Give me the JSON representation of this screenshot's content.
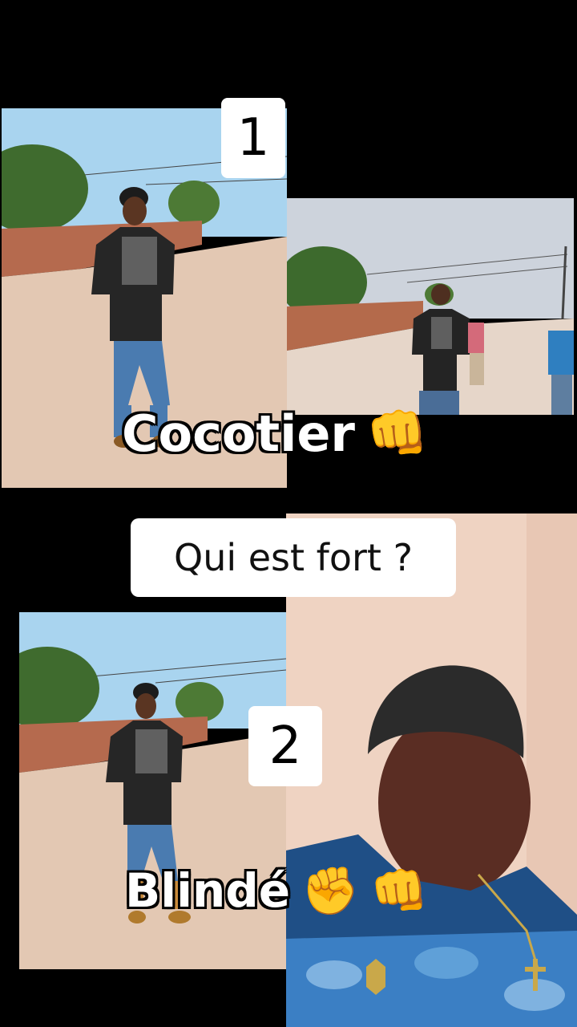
{
  "badges": {
    "first": "1",
    "second": "2"
  },
  "question": "Qui est fort ?",
  "captions": {
    "first": {
      "text": "Cocotier",
      "emoji": "👊"
    },
    "second": {
      "text": "Blindé",
      "emoji1": "✊",
      "emoji2": "👊"
    }
  },
  "colors": {
    "background": "#000000",
    "sky": "#a9d4ef",
    "brick_wall": "#b56a4e",
    "road": "#e3c8b3",
    "beanie": "#2b2b2b",
    "camo_blue": "#3b7fc4"
  }
}
